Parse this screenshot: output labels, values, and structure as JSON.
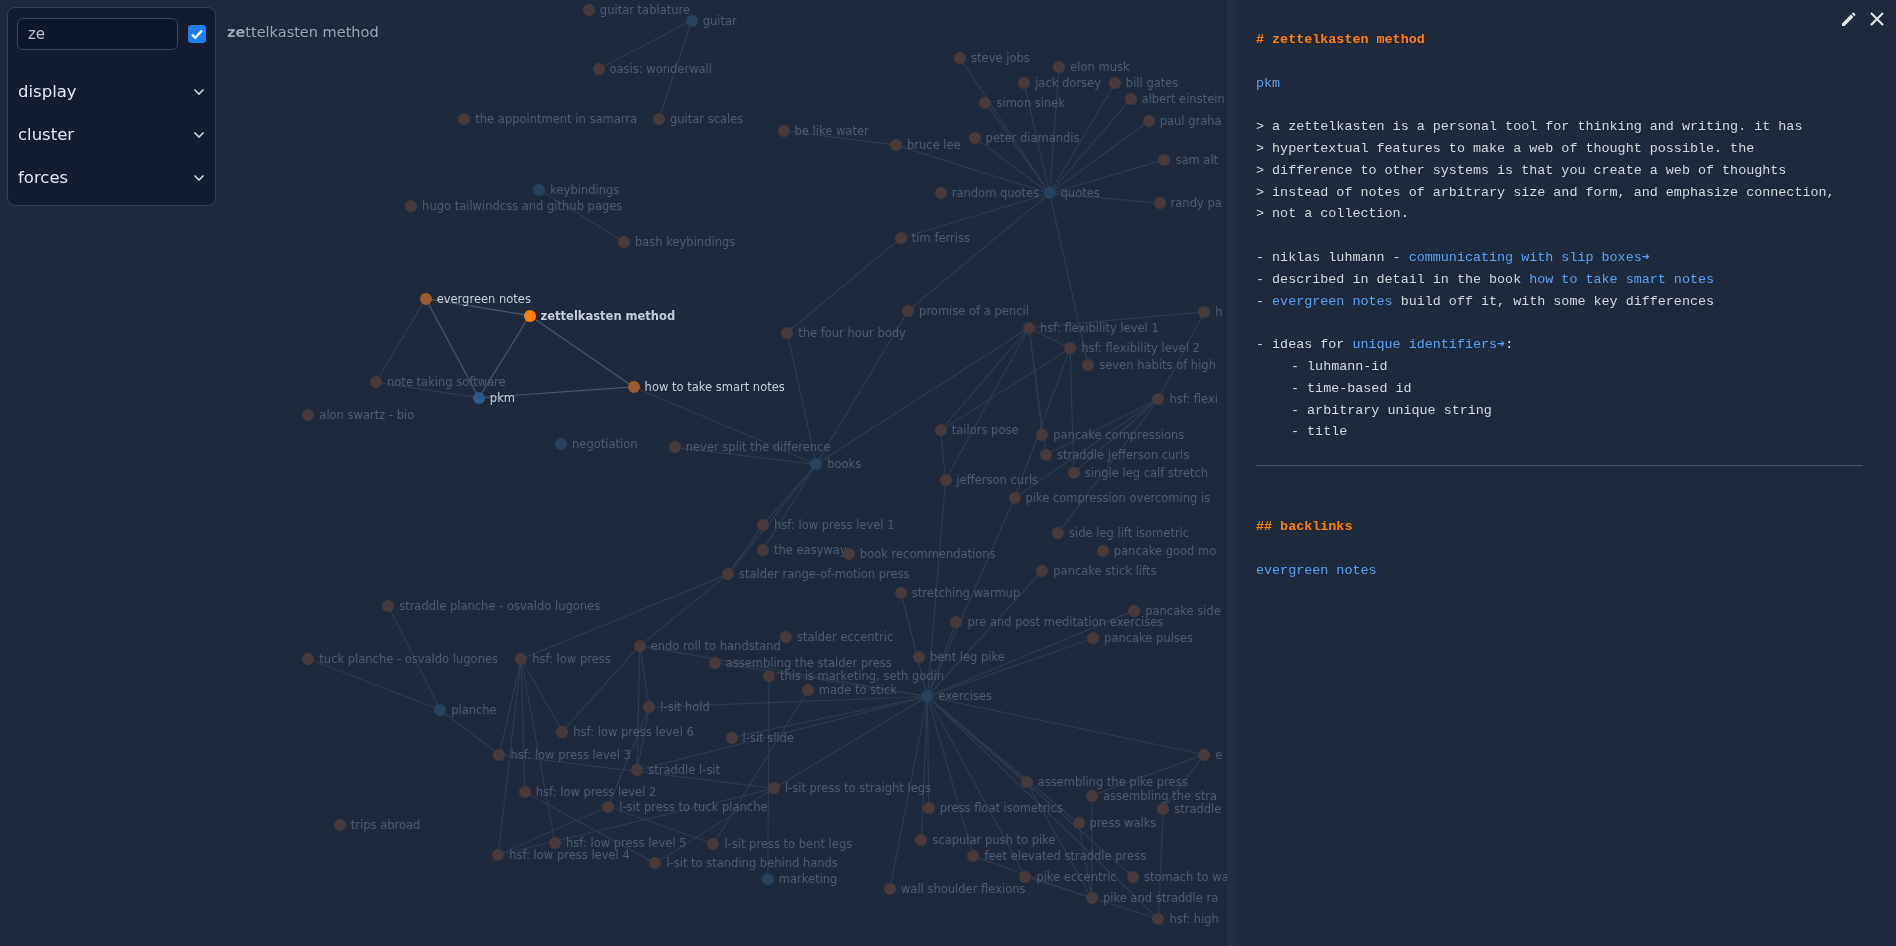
{
  "controls": {
    "search": {
      "value": "ze"
    },
    "filter_checkbox": {
      "checked": true
    },
    "results": [
      "**ze**ttelkasten method"
    ],
    "sections": [
      {
        "label": "display",
        "expanded": false
      },
      {
        "label": "cluster",
        "expanded": false
      },
      {
        "label": "forces",
        "expanded": false
      }
    ]
  },
  "graph": {
    "nodes": [
      {
        "label": "guitar tablature",
        "kind": "note",
        "highlighted": false,
        "selected": false
      },
      {
        "label": "guitar",
        "kind": "tag",
        "highlighted": false,
        "selected": false
      },
      {
        "label": "oasis: wonderwall",
        "kind": "note",
        "highlighted": false,
        "selected": false
      },
      {
        "label": "steve jobs",
        "kind": "note",
        "highlighted": false,
        "selected": false
      },
      {
        "label": "elon musk",
        "kind": "note",
        "highlighted": false,
        "selected": false
      },
      {
        "label": "jack dorsey",
        "kind": "note",
        "highlighted": false,
        "selected": false
      },
      {
        "label": "bill gates",
        "kind": "note",
        "highlighted": false,
        "selected": false
      },
      {
        "label": "simon sinek",
        "kind": "note",
        "highlighted": false,
        "selected": false
      },
      {
        "label": "albert einstein",
        "kind": "note",
        "highlighted": false,
        "selected": false
      },
      {
        "label": "the appointment in samarra",
        "kind": "note",
        "highlighted": false,
        "selected": false
      },
      {
        "label": "guitar scales",
        "kind": "note",
        "highlighted": false,
        "selected": false
      },
      {
        "label": "be like water",
        "kind": "note",
        "highlighted": false,
        "selected": false
      },
      {
        "label": "paul graha",
        "kind": "note",
        "highlighted": false,
        "selected": false
      },
      {
        "label": "bruce lee",
        "kind": "note",
        "highlighted": false,
        "selected": false
      },
      {
        "label": "peter diamandis",
        "kind": "note",
        "highlighted": false,
        "selected": false
      },
      {
        "label": "sam alt",
        "kind": "note",
        "highlighted": false,
        "selected": false
      },
      {
        "label": "keybindings",
        "kind": "tag",
        "highlighted": false,
        "selected": false
      },
      {
        "label": "hugo tailwindcss and github pages",
        "kind": "note",
        "highlighted": false,
        "selected": false
      },
      {
        "label": "random quotes",
        "kind": "note",
        "highlighted": false,
        "selected": false
      },
      {
        "label": "quotes",
        "kind": "tag",
        "highlighted": false,
        "selected": false
      },
      {
        "label": "randy pa",
        "kind": "note",
        "highlighted": false,
        "selected": false
      },
      {
        "label": "bash keybindings",
        "kind": "note",
        "highlighted": false,
        "selected": false
      },
      {
        "label": "tim ferriss",
        "kind": "note",
        "highlighted": false,
        "selected": false
      },
      {
        "label": "evergreen notes",
        "kind": "note",
        "highlighted": true,
        "selected": false
      },
      {
        "label": "zettelkasten method",
        "kind": "note",
        "highlighted": true,
        "selected": true
      },
      {
        "label": "promise of a pencil",
        "kind": "note",
        "highlighted": false,
        "selected": false
      },
      {
        "label": "h",
        "kind": "note",
        "highlighted": false,
        "selected": false
      },
      {
        "label": "the four hour body",
        "kind": "note",
        "highlighted": false,
        "selected": false
      },
      {
        "label": "hsf: flexibility level 1",
        "kind": "note",
        "highlighted": false,
        "selected": false
      },
      {
        "label": "hsf: flexibility level 2",
        "kind": "note",
        "highlighted": false,
        "selected": false
      },
      {
        "label": "seven habits of high",
        "kind": "note",
        "highlighted": false,
        "selected": false
      },
      {
        "label": "note taking software",
        "kind": "note",
        "highlighted": false,
        "selected": false
      },
      {
        "label": "pkm",
        "kind": "tag",
        "highlighted": true,
        "selected": false
      },
      {
        "label": "how to take smart notes",
        "kind": "note",
        "highlighted": true,
        "selected": false
      },
      {
        "label": "hsf: flexi",
        "kind": "note",
        "highlighted": false,
        "selected": false
      },
      {
        "label": "alon swartz - bio",
        "kind": "note",
        "highlighted": false,
        "selected": false
      },
      {
        "label": "negotiation",
        "kind": "tag",
        "highlighted": false,
        "selected": false
      },
      {
        "label": "tailors pose",
        "kind": "note",
        "highlighted": false,
        "selected": false
      },
      {
        "label": "never split the difference",
        "kind": "note",
        "highlighted": false,
        "selected": false
      },
      {
        "label": "pancake compressions",
        "kind": "note",
        "highlighted": false,
        "selected": false
      },
      {
        "label": "books",
        "kind": "tag",
        "highlighted": false,
        "selected": false
      },
      {
        "label": "straddle jefferson curls",
        "kind": "note",
        "highlighted": false,
        "selected": false
      },
      {
        "label": "jefferson curls",
        "kind": "note",
        "highlighted": false,
        "selected": false
      },
      {
        "label": "single leg calf stretch",
        "kind": "note",
        "highlighted": false,
        "selected": false
      },
      {
        "label": "pike compression overcoming is",
        "kind": "note",
        "highlighted": false,
        "selected": false
      },
      {
        "label": "hsf: low press level 1",
        "kind": "note",
        "highlighted": false,
        "selected": false
      },
      {
        "label": "side leg lift isometric",
        "kind": "note",
        "highlighted": false,
        "selected": false
      },
      {
        "label": "the easyway",
        "kind": "note",
        "highlighted": false,
        "selected": false
      },
      {
        "label": "book recommendations",
        "kind": "note",
        "highlighted": false,
        "selected": false
      },
      {
        "label": "pancake good mo",
        "kind": "note",
        "highlighted": false,
        "selected": false
      },
      {
        "label": "stalder range-of-motion press",
        "kind": "note",
        "highlighted": false,
        "selected": false
      },
      {
        "label": "pancake stick lifts",
        "kind": "note",
        "highlighted": false,
        "selected": false
      },
      {
        "label": "stretching warmup",
        "kind": "note",
        "highlighted": false,
        "selected": false
      },
      {
        "label": "straddle planche - osvaldo lugones",
        "kind": "note",
        "highlighted": false,
        "selected": false
      },
      {
        "label": "pre and post meditation exercises",
        "kind": "note",
        "highlighted": false,
        "selected": false
      },
      {
        "label": "pancake side",
        "kind": "note",
        "highlighted": false,
        "selected": false
      },
      {
        "label": "endo roll to handstand",
        "kind": "note",
        "highlighted": false,
        "selected": false
      },
      {
        "label": "stalder eccentric",
        "kind": "note",
        "highlighted": false,
        "selected": false
      },
      {
        "label": "pancake pulses",
        "kind": "note",
        "highlighted": false,
        "selected": false
      },
      {
        "label": "tuck planche - osvaldo lugones",
        "kind": "note",
        "highlighted": false,
        "selected": false
      },
      {
        "label": "hsf: low press",
        "kind": "note",
        "highlighted": false,
        "selected": false
      },
      {
        "label": "assembling the stalder press",
        "kind": "note",
        "highlighted": false,
        "selected": false
      },
      {
        "label": "bent leg pike",
        "kind": "note",
        "highlighted": false,
        "selected": false
      },
      {
        "label": "this is marketing, seth godin",
        "kind": "note",
        "highlighted": false,
        "selected": false
      },
      {
        "label": "made to stick",
        "kind": "note",
        "highlighted": false,
        "selected": false
      },
      {
        "label": "planche",
        "kind": "tag",
        "highlighted": false,
        "selected": false
      },
      {
        "label": "l-sit hold",
        "kind": "note",
        "highlighted": false,
        "selected": false
      },
      {
        "label": "exercises",
        "kind": "tag",
        "highlighted": false,
        "selected": false
      },
      {
        "label": "hsf: low press level 6",
        "kind": "note",
        "highlighted": false,
        "selected": false
      },
      {
        "label": "l-sit slide",
        "kind": "note",
        "highlighted": false,
        "selected": false
      },
      {
        "label": "hsf: low press level 3",
        "kind": "note",
        "highlighted": false,
        "selected": false
      },
      {
        "label": "e",
        "kind": "note",
        "highlighted": false,
        "selected": false
      },
      {
        "label": "straddle l-sit",
        "kind": "note",
        "highlighted": false,
        "selected": false
      },
      {
        "label": "hsf: low press level 2",
        "kind": "note",
        "highlighted": false,
        "selected": false
      },
      {
        "label": "l-sit press to straight legs",
        "kind": "note",
        "highlighted": false,
        "selected": false
      },
      {
        "label": "assembling the pike press",
        "kind": "note",
        "highlighted": false,
        "selected": false
      },
      {
        "label": "l-sit press to tuck planche",
        "kind": "note",
        "highlighted": false,
        "selected": false
      },
      {
        "label": "press float isometrics",
        "kind": "note",
        "highlighted": false,
        "selected": false
      },
      {
        "label": "assembling the stra",
        "kind": "note",
        "highlighted": false,
        "selected": false
      },
      {
        "label": "straddle",
        "kind": "note",
        "highlighted": false,
        "selected": false
      },
      {
        "label": "trips abroad",
        "kind": "note",
        "highlighted": false,
        "selected": false
      },
      {
        "label": "press walks",
        "kind": "note",
        "highlighted": false,
        "selected": false
      },
      {
        "label": "hsf: low press level 4",
        "kind": "note",
        "highlighted": false,
        "selected": false
      },
      {
        "label": "hsf: low press level 5",
        "kind": "note",
        "highlighted": false,
        "selected": false
      },
      {
        "label": "l-sit press to bent legs",
        "kind": "note",
        "highlighted": false,
        "selected": false
      },
      {
        "label": "scapular push to pike",
        "kind": "note",
        "highlighted": false,
        "selected": false
      },
      {
        "label": "l-sit to standing behind hands",
        "kind": "note",
        "highlighted": false,
        "selected": false
      },
      {
        "label": "feet elevated straddle press",
        "kind": "note",
        "highlighted": false,
        "selected": false
      },
      {
        "label": "marketing",
        "kind": "tag",
        "highlighted": false,
        "selected": false
      },
      {
        "label": "wall shoulder flexions",
        "kind": "note",
        "highlighted": false,
        "selected": false
      },
      {
        "label": "pike eccentric",
        "kind": "note",
        "highlighted": false,
        "selected": false
      },
      {
        "label": "stomach to wa",
        "kind": "note",
        "highlighted": false,
        "selected": false
      },
      {
        "label": "pike and straddle ra",
        "kind": "note",
        "highlighted": false,
        "selected": false
      },
      {
        "label": "hsf: high",
        "kind": "note",
        "highlighted": false,
        "selected": false
      }
    ]
  },
  "note": {
    "blocks": [
      {
        "kind": "heading",
        "text": "# zettelkasten method"
      },
      {
        "kind": "lines",
        "lines": [
          {
            "segments": [
              {
                "text": "pkm",
                "link": true
              }
            ]
          }
        ]
      },
      {
        "kind": "lines",
        "lines": [
          {
            "segments": [
              {
                "text": "> a zettelkasten is a personal tool for thinking and writing. it has",
                "link": false
              }
            ]
          },
          {
            "segments": [
              {
                "text": "> hypertextual features to make a web of thought possible. the",
                "link": false
              }
            ]
          },
          {
            "segments": [
              {
                "text": "> difference to other systems is that you create a web of thoughts",
                "link": false
              }
            ]
          },
          {
            "segments": [
              {
                "text": "> instead of notes of arbitrary size and form, and emphasize connection,",
                "link": false
              }
            ]
          },
          {
            "segments": [
              {
                "text": "> not a collection.",
                "link": false
              }
            ]
          }
        ]
      },
      {
        "kind": "lines",
        "lines": [
          {
            "segments": [
              {
                "text": "- niklas luhmann - ",
                "link": false
              },
              {
                "text": "communicating with slip boxes➔",
                "link": true
              }
            ]
          },
          {
            "segments": [
              {
                "text": "- described in detail in the book ",
                "link": false
              },
              {
                "text": "how to take smart notes",
                "link": true
              }
            ]
          },
          {
            "segments": [
              {
                "text": "- ",
                "link": false
              },
              {
                "text": "evergreen notes",
                "link": true
              },
              {
                "text": " build off it, with some key differences",
                "link": false
              }
            ]
          }
        ]
      },
      {
        "kind": "lines",
        "lines": [
          {
            "segments": [
              {
                "text": "- ideas for ",
                "link": false
              },
              {
                "text": "unique identifiers➔",
                "link": true
              },
              {
                "text": ":",
                "link": false
              }
            ],
            "children": [
              {
                "segments": [
                  {
                    "text": "- luhmann-id",
                    "link": false
                  }
                ]
              },
              {
                "segments": [
                  {
                    "text": "- time-based id",
                    "link": false
                  }
                ]
              },
              {
                "segments": [
                  {
                    "text": "- arbitrary unique string",
                    "link": false
                  }
                ]
              },
              {
                "segments": [
                  {
                    "text": "- title",
                    "link": false
                  }
                ]
              }
            ]
          }
        ]
      },
      {
        "kind": "rule"
      },
      {
        "kind": "heading",
        "text": "## backlinks"
      },
      {
        "kind": "lines",
        "lines": [
          {
            "segments": [
              {
                "text": "evergreen notes",
                "link": true
              }
            ]
          }
        ]
      }
    ]
  }
}
